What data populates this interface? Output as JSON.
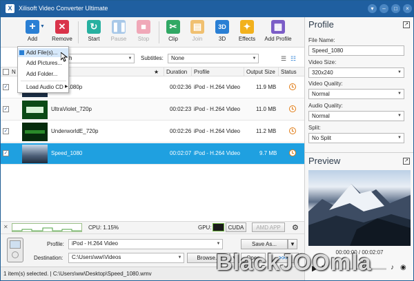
{
  "window": {
    "title": "Xilisoft Video Converter Ultimate",
    "icon": "app-logo-icon"
  },
  "toolbar": {
    "add": "Add",
    "remove": "Remove",
    "start": "Start",
    "pause": "Pause",
    "stop": "Stop",
    "clip": "Clip",
    "join": "Join",
    "three_d_icon": "3D",
    "three_d": "3D",
    "effects": "Effects",
    "add_profile": "Add Profile"
  },
  "add_menu": {
    "items": [
      "Add File(s)...",
      "Add Pictures...",
      "Add Folder...",
      "Load Audio CD"
    ]
  },
  "filter": {
    "search_text": "ch",
    "subtitles_label": "Subtitles:",
    "subtitles_value": "None"
  },
  "table": {
    "headers": {
      "name": "N",
      "duration": "Duration",
      "profile": "Profile",
      "output_size": "Output Size",
      "status": "Status"
    },
    "rows": [
      {
        "name": "1080p",
        "duration": "00:02:36",
        "profile": "iPod - H.264 Video",
        "size": "11.9 MB",
        "check": "✓"
      },
      {
        "name": "UltraViolet_720p",
        "duration": "00:02:23",
        "profile": "iPod - H.264 Video",
        "size": "11.0 MB",
        "check": "✓"
      },
      {
        "name": "UnderworldE_720p",
        "duration": "00:02:26",
        "profile": "iPod - H.264 Video",
        "size": "11.2 MB",
        "check": "✓"
      },
      {
        "name": "Speed_1080",
        "duration": "00:02:07",
        "profile": "iPod - H.264 Video",
        "size": "9.7 MB",
        "check": "✓"
      }
    ]
  },
  "status_row": {
    "cpu": "CPU: 1.15%",
    "gpu_label": "GPU:",
    "cuda": "CUDA",
    "amd_app": "AMD APP",
    "close_glyph": "✕"
  },
  "bottom": {
    "profile_label": "Profile:",
    "profile_value": "iPod - H.264 Video",
    "save_as": "Save As...",
    "destination_label": "Destination:",
    "destination_value": "C:\\Users\\ww\\Videos",
    "browse": "Browse...",
    "open": "Open",
    "convert_glyph": ">>>"
  },
  "statusbar": {
    "text": "1 item(s) selected. | C:\\Users\\ww\\Desktop\\Speed_1080.wmv"
  },
  "profile_panel": {
    "title": "Profile",
    "file_name_label": "File Name:",
    "file_name": "Speed_1080",
    "video_size_label": "Video Size:",
    "video_size": "320x240",
    "video_quality_label": "Video Quality:",
    "video_quality": "Normal",
    "audio_quality_label": "Audio Quality:",
    "audio_quality": "Normal",
    "split_label": "Split:",
    "split": "No Split"
  },
  "preview": {
    "title": "Preview",
    "time": "00:00:00 / 00:02:07"
  },
  "watermark": "BlackJOOmla"
}
